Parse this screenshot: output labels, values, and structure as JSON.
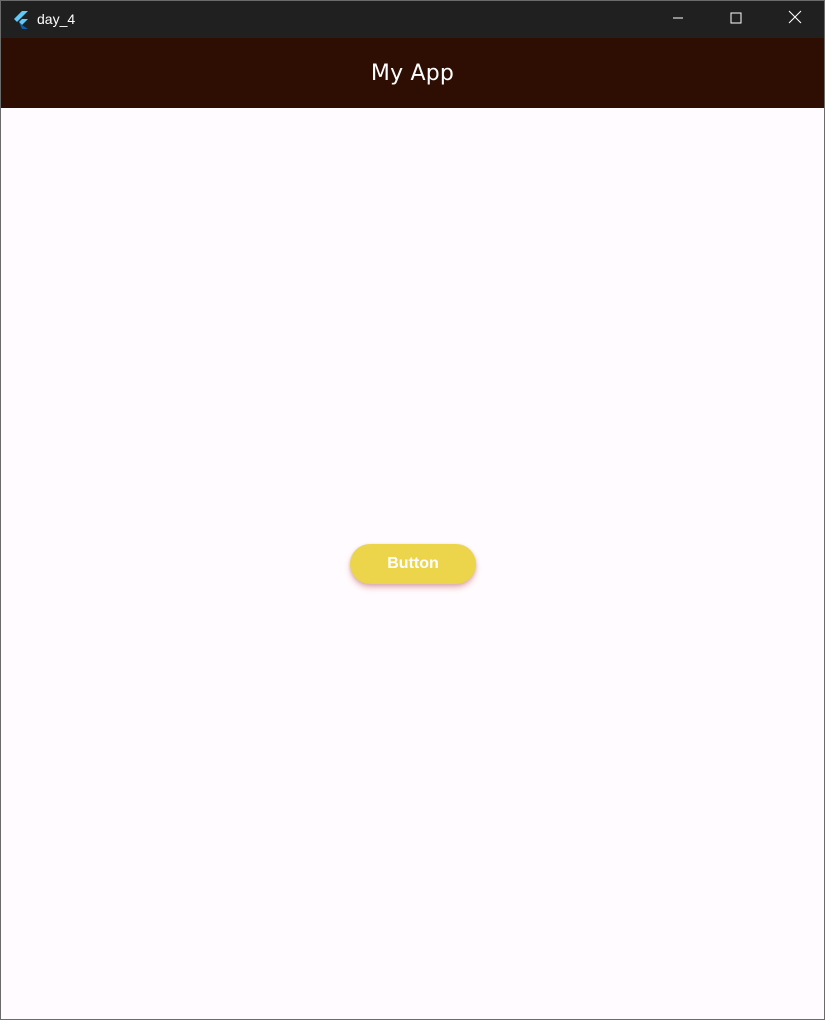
{
  "window": {
    "title": "day_4",
    "icon": "flutter-logo-icon",
    "controls": [
      "minimize-icon",
      "maximize-icon",
      "close-icon"
    ]
  },
  "appbar": {
    "title": "My App",
    "background": "#2e0e02",
    "title_color": "#ffffff"
  },
  "main": {
    "background": "#fffbfe",
    "button_label": "Button",
    "button_color": "#ecd54a",
    "button_text_color": "#ffffff"
  }
}
